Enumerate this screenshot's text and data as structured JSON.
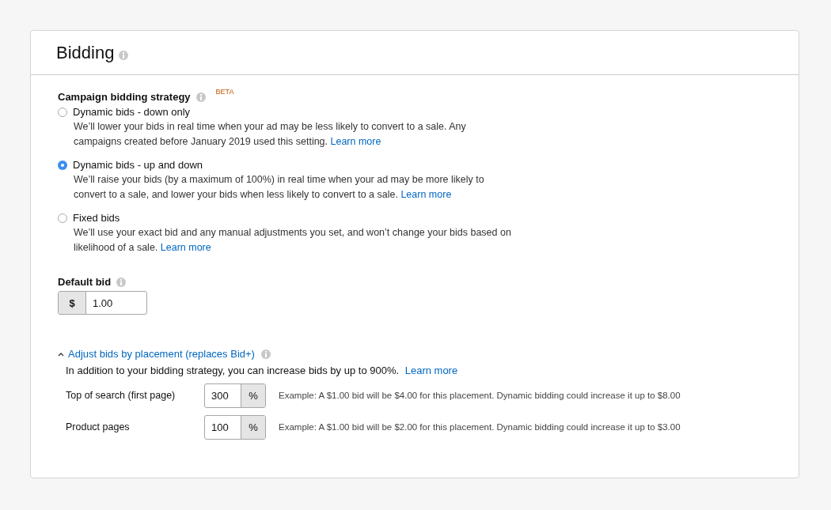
{
  "title": "Bidding",
  "strategy": {
    "label": "Campaign bidding strategy",
    "badge": "BETA",
    "options": [
      {
        "label": "Dynamic bids - down only",
        "selected": false,
        "description": "We’ll lower your bids in real time when your ad may be less likely to convert to a sale. Any campaigns created before January 2019 used this setting.",
        "link": "Learn more"
      },
      {
        "label": "Dynamic bids - up and down",
        "selected": true,
        "description": "We’ll raise your bids (by a maximum of 100%) in real time when your ad may be more likely to convert to a sale, and lower your bids when less likely to convert to a sale.",
        "link": "Learn more"
      },
      {
        "label": "Fixed bids",
        "selected": false,
        "description": "We’ll use your exact bid and any manual adjustments you set, and won’t change your bids based on likelihood of a sale.",
        "link": "Learn more"
      }
    ]
  },
  "default_bid": {
    "label": "Default bid",
    "prefix": "$",
    "value": "1.00"
  },
  "placement": {
    "toggle": "Adjust bids by placement (replaces Bid+)",
    "expanded": true,
    "intro": "In addition to your bidding strategy, you can increase bids by up to 900%.",
    "link": "Learn more",
    "rows": [
      {
        "label": "Top of search (first page)",
        "value": "300",
        "suffix": "%",
        "example": "Example: A $1.00 bid will be $4.00 for this placement. Dynamic bidding could increase it up to $8.00"
      },
      {
        "label": "Product pages",
        "value": "100",
        "suffix": "%",
        "example": "Example: A $1.00 bid will be $2.00 for this placement. Dynamic bidding could increase it up to $3.00"
      }
    ]
  }
}
